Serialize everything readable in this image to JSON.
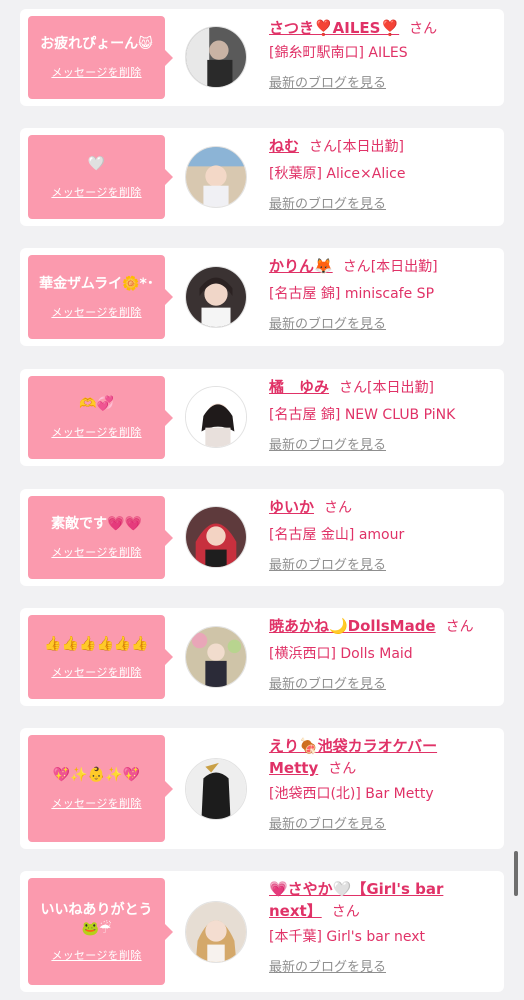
{
  "delete_label": "メッセージを削除",
  "blog_label": "最新のブログを見る",
  "san_label": "さん",
  "items": [
    {
      "message": "お疲れぴょーん😸",
      "name": "さつき❣️AILES❣️",
      "status": "",
      "shop": "[錦糸町駅南口] AILES"
    },
    {
      "message": "🤍",
      "name": "ねむ",
      "status": "[本日出勤]",
      "shop": "[秋葉原] Alice×Alice"
    },
    {
      "message": "華金ザムライ🌼*･",
      "name": "かりん🦊",
      "status": "[本日出勤]",
      "shop": "[名古屋 錦] miniscafe SP"
    },
    {
      "message": "🫶💞",
      "name": "橘　ゆみ",
      "status": "[本日出勤]",
      "shop": "[名古屋 錦] NEW CLUB PiNK"
    },
    {
      "message": "素敵です💗💗",
      "name": "ゆいか",
      "status": "",
      "shop": "[名古屋 金山] amour"
    },
    {
      "message": "👍👍👍👍👍👍",
      "name": "暁あかね🌙DollsMade",
      "status": "",
      "shop": "[横浜西口] Dolls Maid"
    },
    {
      "message": "💖✨👶✨💖",
      "name_line1": "えり🍖池袋カラオケバー",
      "name_line2": "Metty",
      "status": "",
      "shop": "[池袋西口(北)] Bar Metty"
    },
    {
      "message_line1": "いいねありがとう",
      "message_line2": "🐸☔",
      "name_line1": "💗さやか🤍【Girl's bar",
      "name_line2": "next】",
      "status": "",
      "shop": "[本千葉] Girl's bar next"
    }
  ]
}
